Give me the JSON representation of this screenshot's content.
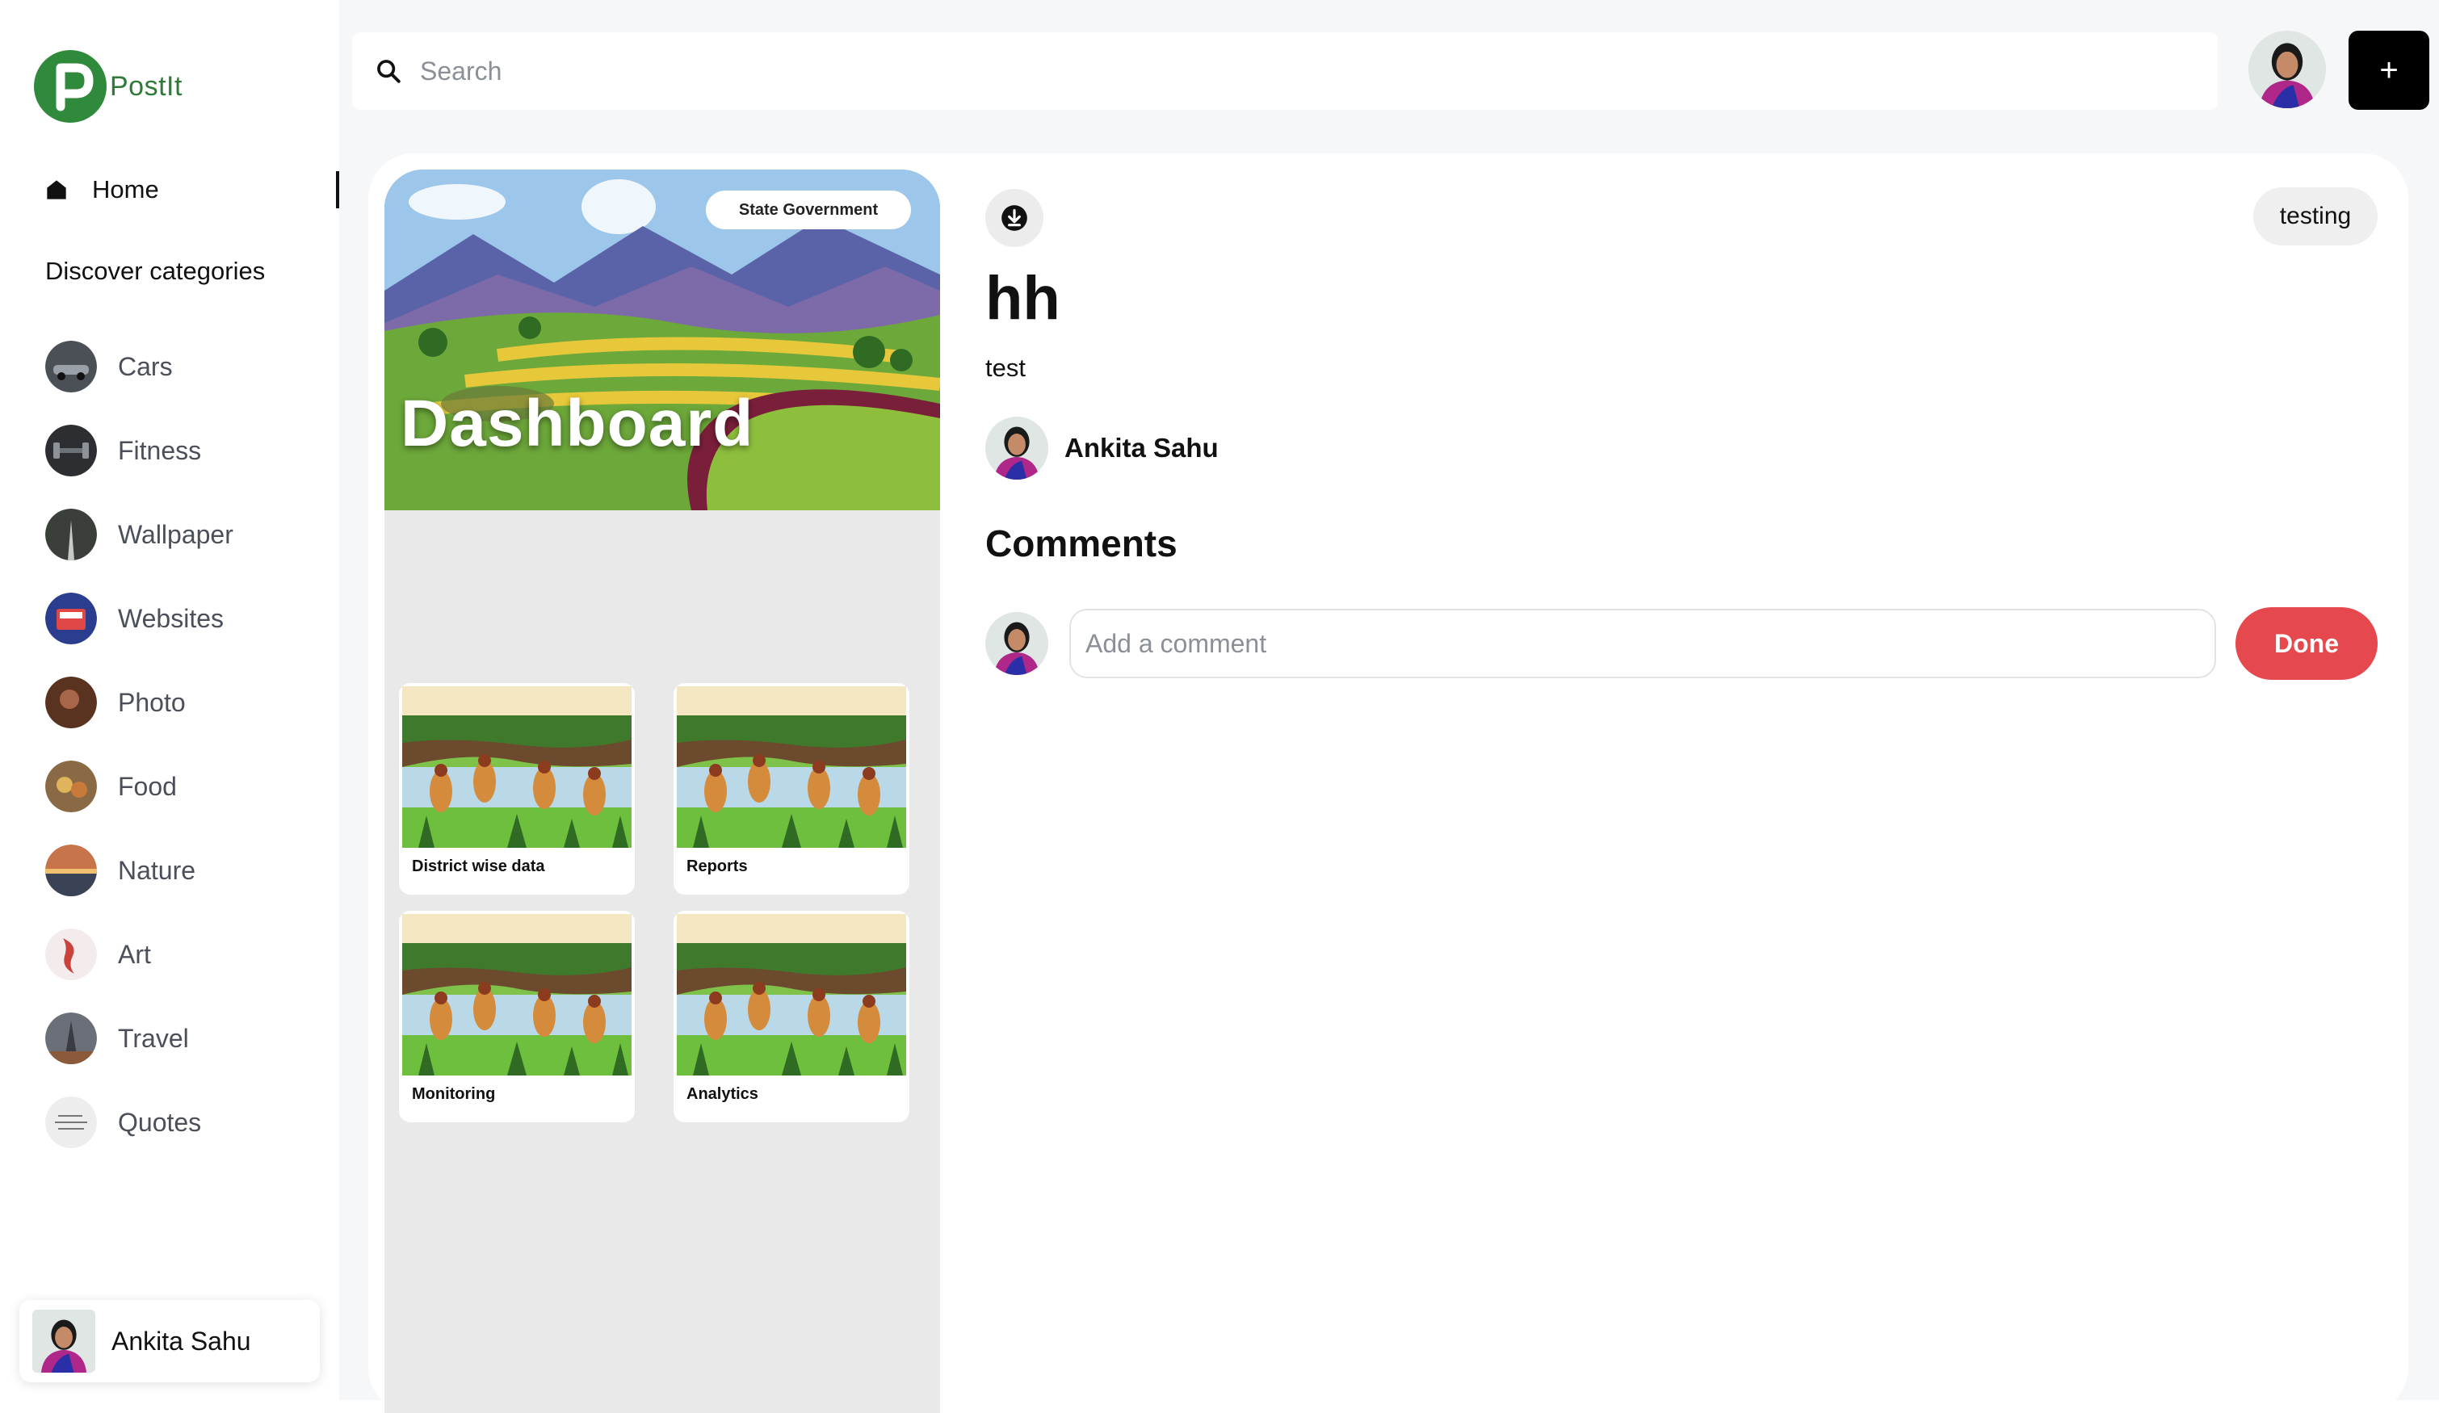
{
  "app": {
    "name": "PostIt",
    "brand_color": "#2f8a3c"
  },
  "sidebar": {
    "home_label": "Home",
    "discover_title": "Discover categories",
    "categories": [
      {
        "label": "Cars",
        "thumb_color": "#4b5057"
      },
      {
        "label": "Fitness",
        "thumb_color": "#2c2e31"
      },
      {
        "label": "Wallpaper",
        "thumb_color": "#3a3f3a"
      },
      {
        "label": "Websites",
        "thumb_color": "#2a3d8f"
      },
      {
        "label": "Photo",
        "thumb_color": "#5a3220"
      },
      {
        "label": "Food",
        "thumb_color": "#8a6a44"
      },
      {
        "label": "Nature",
        "thumb_color": "#c7744a"
      },
      {
        "label": "Art",
        "thumb_color": "#d98a86"
      },
      {
        "label": "Travel",
        "thumb_color": "#6b6f78"
      },
      {
        "label": "Quotes",
        "thumb_color": "#ededed"
      }
    ],
    "profile_name": "Ankita Sahu"
  },
  "header": {
    "search_placeholder": "Search",
    "add_label": "+"
  },
  "pin": {
    "image": {
      "badge": "State Government",
      "title": "Dashboard",
      "tiles": [
        "District wise data",
        "Reports",
        "Monitoring",
        "Analytics"
      ]
    },
    "tag": "testing",
    "title": "hh",
    "description": "test",
    "author": "Ankita Sahu"
  },
  "comments": {
    "title": "Comments",
    "input_placeholder": "Add a comment",
    "submit_label": "Done",
    "submit_color": "#e5484d"
  }
}
